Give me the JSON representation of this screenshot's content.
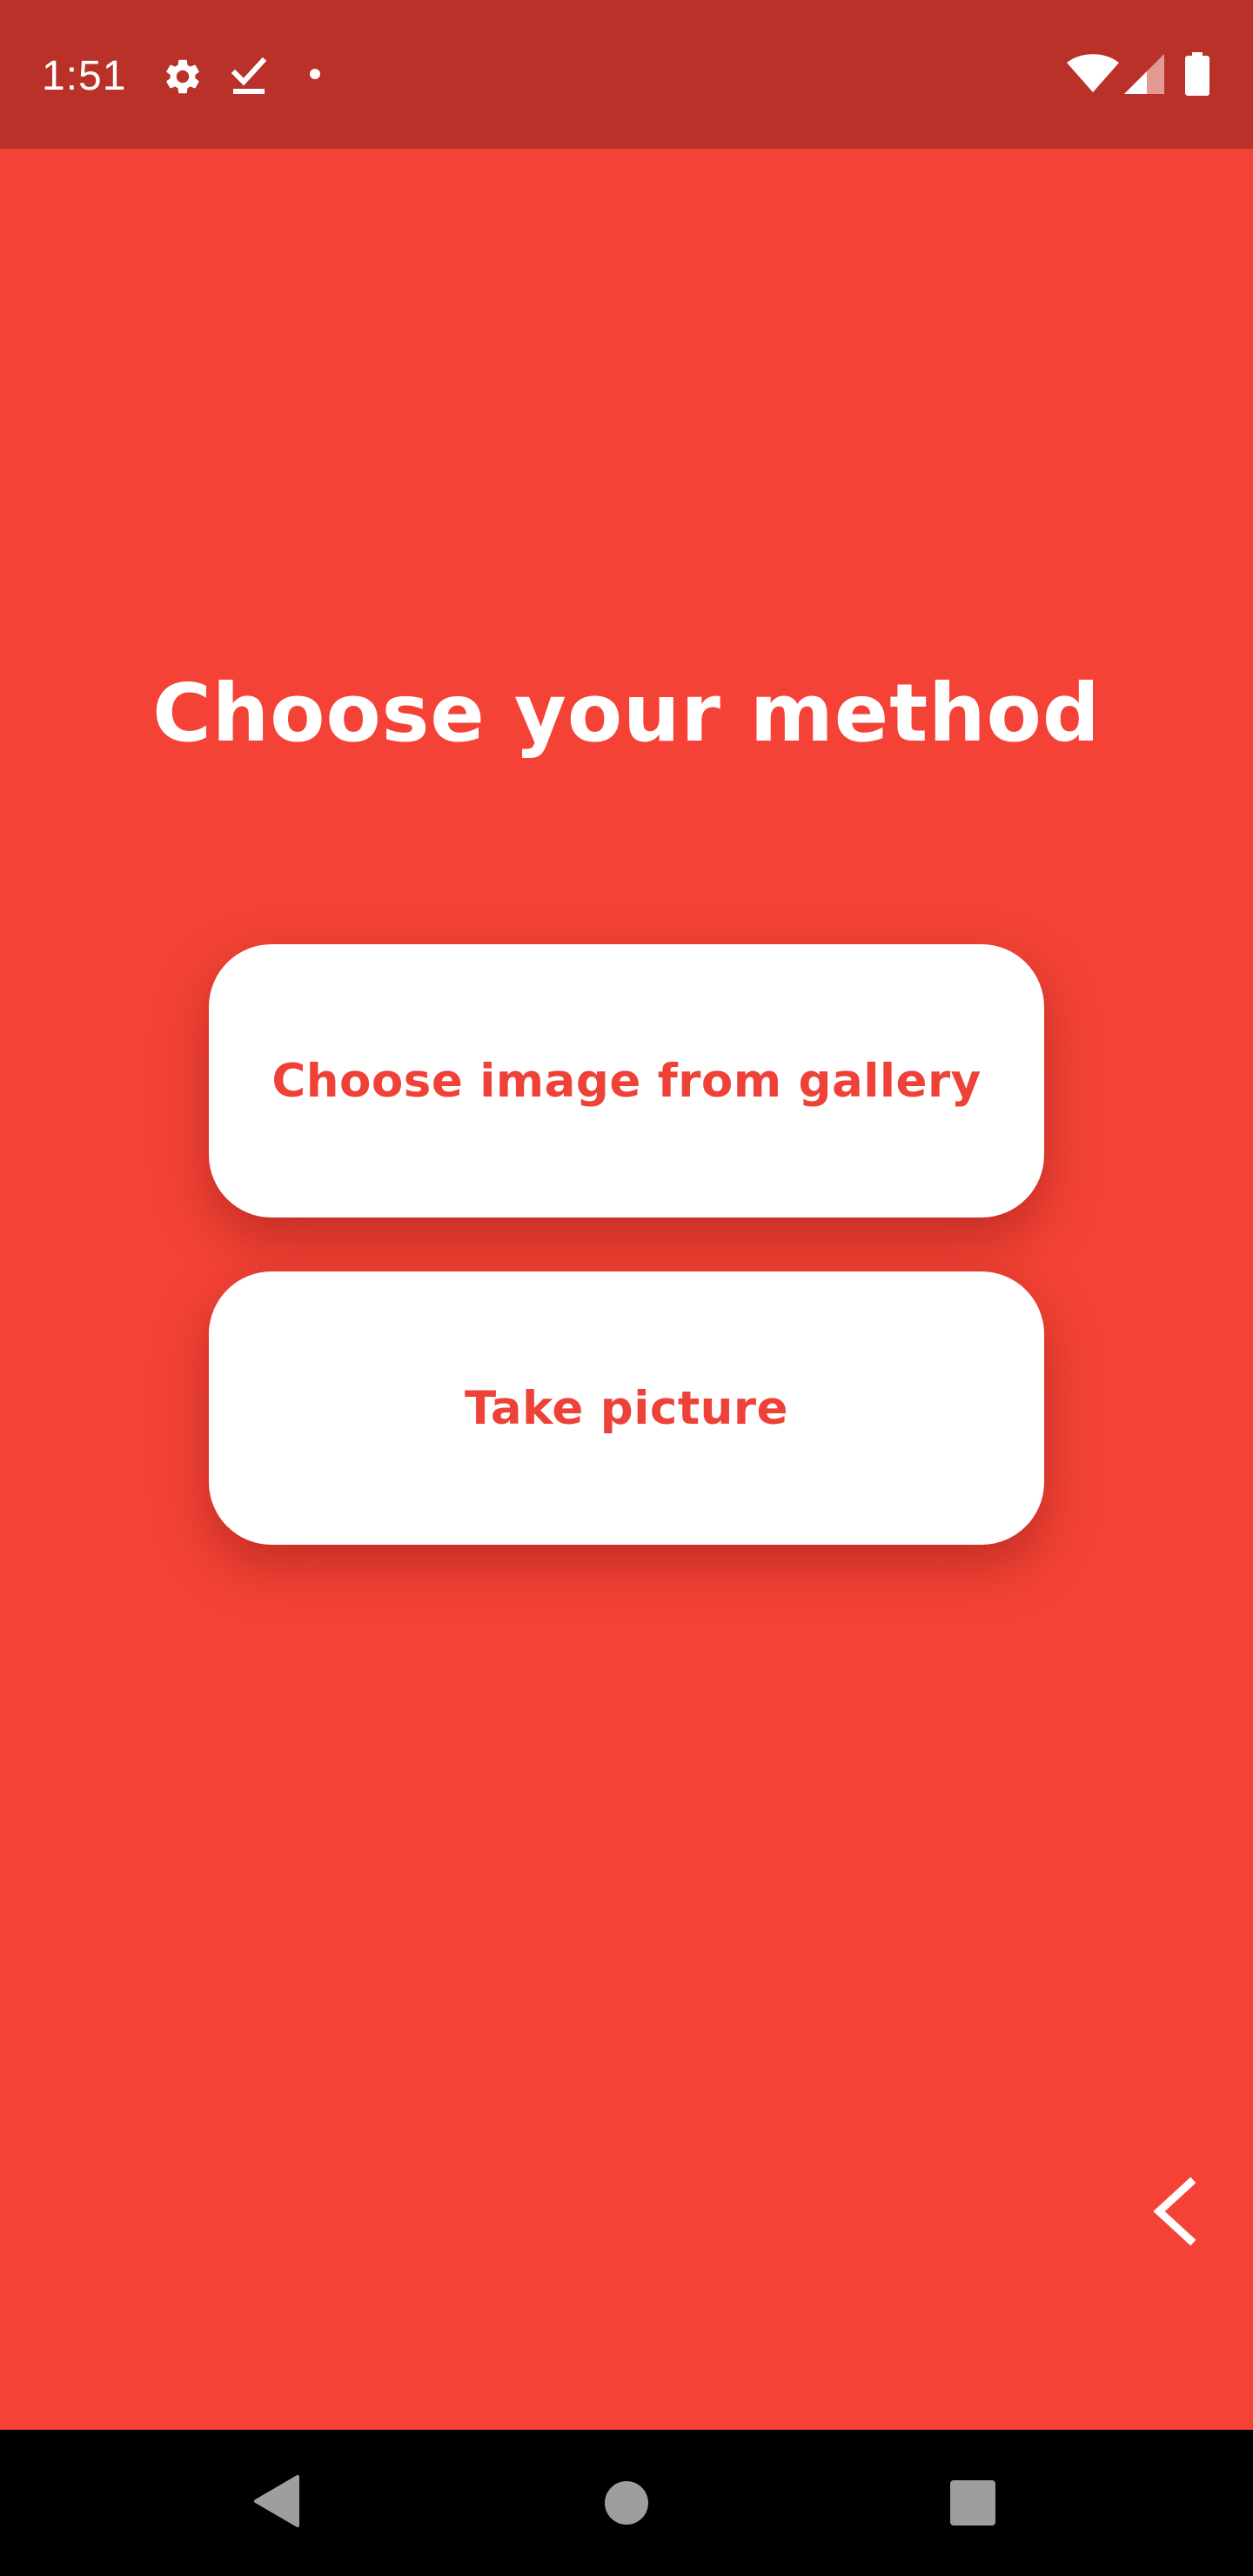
{
  "status_bar": {
    "time": "1:51",
    "left_icons": [
      "gear-icon",
      "task-done-icon",
      "notification-dot-icon"
    ],
    "right_icons": [
      "wifi-icon",
      "cell-signal-icon",
      "battery-icon"
    ]
  },
  "main": {
    "title": "Choose your method",
    "buttons": [
      {
        "label": "Choose image from gallery"
      },
      {
        "label": "Take picture"
      }
    ],
    "back_icon": "chevron-left-icon"
  },
  "nav_bar": {
    "icons": [
      "back-triangle-icon",
      "home-circle-icon",
      "recents-square-icon"
    ]
  },
  "colors": {
    "background": "#F44336",
    "status_bar": "#B93129",
    "button_bg": "#FFFFFF",
    "button_text": "#EE4137",
    "title_text": "#FFFFFF"
  }
}
